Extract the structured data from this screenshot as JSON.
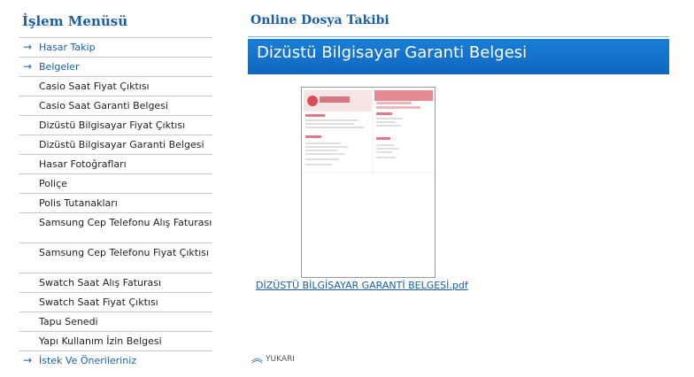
{
  "sidebar": {
    "title": "İşlem Menüsü",
    "items": [
      {
        "label": "Hasar Takip",
        "arrow": true
      },
      {
        "label": "Belgeler",
        "arrow": true
      },
      {
        "label": "Casio Saat Fiyat Çıktısı"
      },
      {
        "label": "Casio Saat Garanti Belgesi"
      },
      {
        "label": "Dizüstü Bilgisayar Fiyat Çıktısı"
      },
      {
        "label": "Dizüstü Bilgisayar Garanti Belgesi"
      },
      {
        "label": "Hasar Fotoğrafları"
      },
      {
        "label": "Poliçe"
      },
      {
        "label": "Polis Tutanakları"
      },
      {
        "label": "Samsung Cep Telefonu Alış Faturası"
      },
      {
        "label": "Samsung Cep Telefonu Fiyat Çıktısı"
      },
      {
        "label": "Swatch Saat Alış Faturası"
      },
      {
        "label": "Swatch Saat Fiyat Çıktısı"
      },
      {
        "label": "Tapu Senedi"
      },
      {
        "label": "Yapı Kullanım İzin Belgesi"
      },
      {
        "label": "İstek Ve Önerileriniz",
        "arrow": true
      }
    ]
  },
  "main": {
    "title": "Online Dosya Takibi",
    "document_title": "Dizüstü Bilgisayar Garanti Belgesi",
    "file_name": "DİZÜSTÜ BİLGİSAYAR GARANTİ BELGESİ.pdf",
    "back_to_top": "YUKARI"
  },
  "colors": {
    "accent": "#1a5fa6",
    "header_bar": "#1a7ed6"
  }
}
